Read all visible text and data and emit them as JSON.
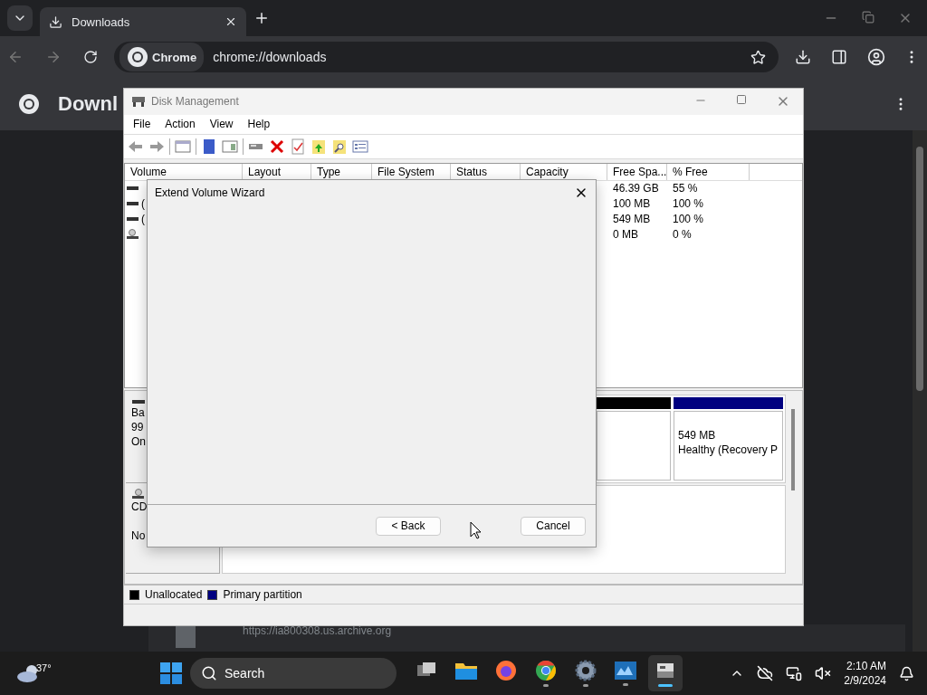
{
  "browser": {
    "tab": {
      "title": "Downloads"
    },
    "omnibox": {
      "chip": "Chrome",
      "url": "chrome://downloads"
    }
  },
  "page": {
    "title": "Downl",
    "item_url": "https://ia800308.us.archive.org"
  },
  "disk_management": {
    "title": "Disk Management",
    "menu": [
      "File",
      "Action",
      "View",
      "Help"
    ],
    "columns": [
      "Volume",
      "Layout",
      "Type",
      "File System",
      "Status",
      "Capacity",
      "Free Spa...",
      "% Free"
    ],
    "rows": [
      {
        "kind": "disk",
        "free_space": "46.39 GB",
        "percent_free": "55 %"
      },
      {
        "kind": "disk",
        "volume": "(",
        "free_space": "100 MB",
        "percent_free": "100 %"
      },
      {
        "kind": "disk",
        "volume": "(",
        "free_space": "549 MB",
        "percent_free": "100 %"
      },
      {
        "kind": "cd",
        "free_space": "0 MB",
        "percent_free": "0 %"
      }
    ],
    "disks": [
      {
        "kind": "basic",
        "lines": [
          "Ba",
          "99",
          "On"
        ]
      },
      {
        "kind": "cdrom",
        "lines": [
          "CD",
          "No"
        ]
      }
    ],
    "partitions": [
      {
        "color": "#000000"
      },
      {
        "color": "#000080",
        "size": "549 MB",
        "status": "Healthy (Recovery P"
      }
    ],
    "legend": [
      {
        "label": "Unallocated",
        "color": "#000000"
      },
      {
        "label": "Primary partition",
        "color": "#000080"
      }
    ]
  },
  "wizard": {
    "title": "Extend Volume Wizard",
    "buttons": [
      "< Back",
      "Cancel"
    ]
  },
  "taskbar": {
    "weather": "37°",
    "search": "Search",
    "apps": [
      {
        "kind": "taskview",
        "running": false,
        "selected": false
      },
      {
        "kind": "explorer",
        "running": false,
        "selected": false
      },
      {
        "kind": "firefox",
        "running": false,
        "selected": false
      },
      {
        "kind": "chrome",
        "running": true,
        "selected": false
      },
      {
        "kind": "settings",
        "running": true,
        "selected": false
      },
      {
        "kind": "photos",
        "running": true,
        "selected": false
      },
      {
        "kind": "diskmgmt",
        "running": true,
        "selected": true
      }
    ],
    "time": "2:10 AM",
    "date": "2/9/2024"
  }
}
